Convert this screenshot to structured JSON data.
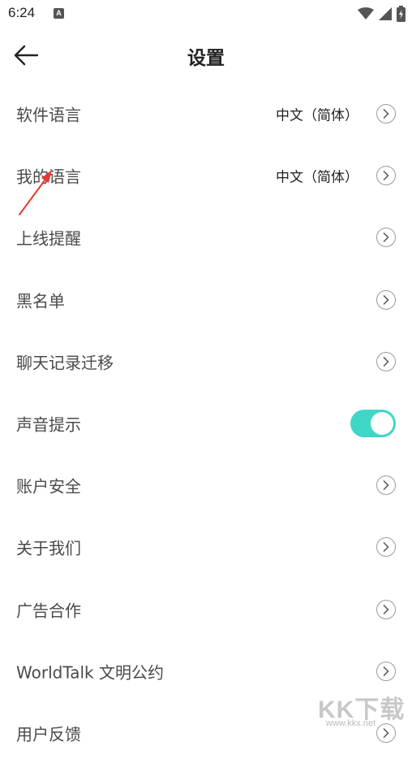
{
  "status_bar": {
    "time": "6:24",
    "notification_icon": "A"
  },
  "header": {
    "title": "设置"
  },
  "settings": [
    {
      "label": "软件语言",
      "value": "中文（简体）",
      "control": "chevron"
    },
    {
      "label": "我的语言",
      "value": "中文（简体）",
      "control": "chevron"
    },
    {
      "label": "上线提醒",
      "value": "",
      "control": "chevron"
    },
    {
      "label": "黑名单",
      "value": "",
      "control": "chevron"
    },
    {
      "label": "聊天记录迁移",
      "value": "",
      "control": "chevron"
    },
    {
      "label": "声音提示",
      "value": "",
      "control": "toggle",
      "toggle_on": true
    },
    {
      "label": "账户安全",
      "value": "",
      "control": "chevron"
    },
    {
      "label": "关于我们",
      "value": "",
      "control": "chevron"
    },
    {
      "label": "广告合作",
      "value": "",
      "control": "chevron"
    },
    {
      "label": "WorldTalk 文明公约",
      "value": "",
      "control": "chevron"
    },
    {
      "label": "用户反馈",
      "value": "",
      "control": "chevron"
    }
  ],
  "watermark": {
    "text": "KK下载",
    "url": "www.kkx.net"
  },
  "colors": {
    "toggle_on": "#3fd7c6",
    "annotation_arrow": "#e53a2f",
    "label_text": "#4a4a4a"
  }
}
